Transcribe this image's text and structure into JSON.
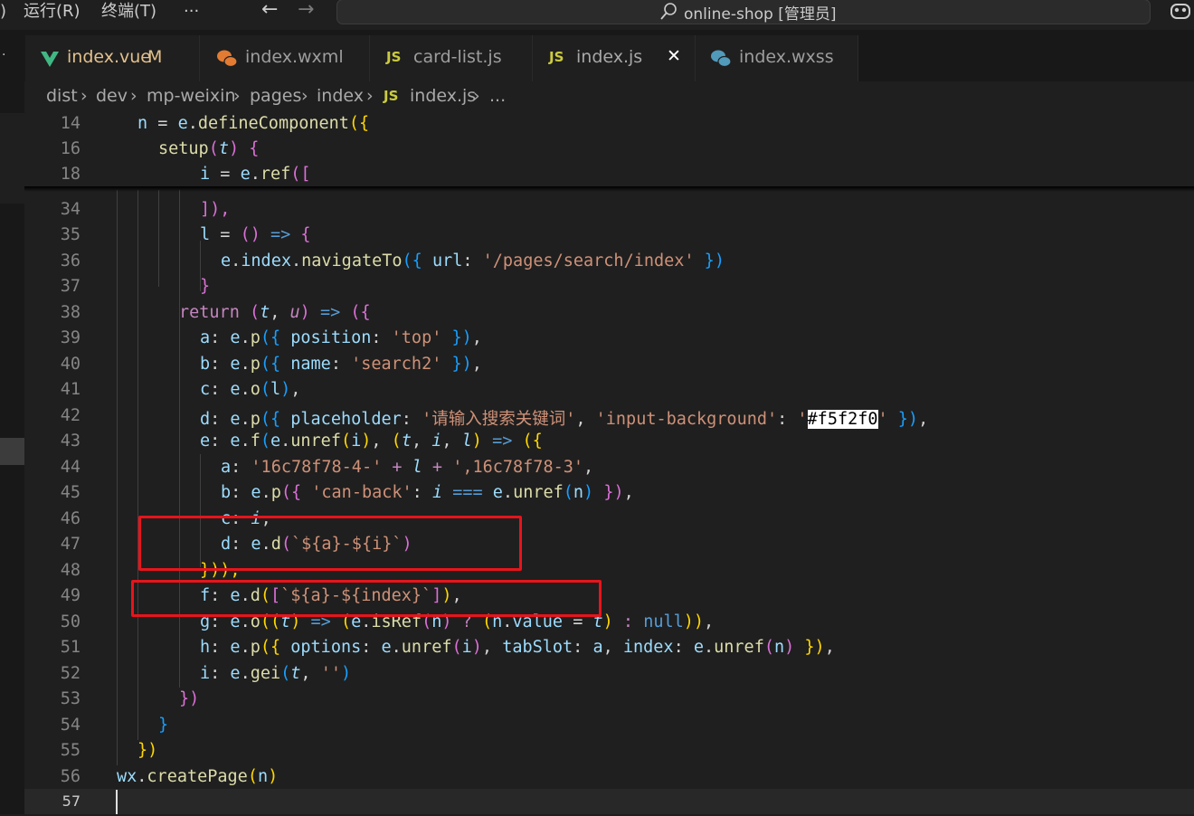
{
  "menu": {
    "run": "运行(R)",
    "terminal": "终端(T)",
    "more": "···",
    "back_icon": "←",
    "forward_icon": "→"
  },
  "command_center": {
    "text": "online-shop [管理员]"
  },
  "tabs": [
    {
      "label": "index.vue",
      "badge": "M",
      "icon": "vue-icon"
    },
    {
      "label": "index.wxml",
      "icon": "wechat-icon"
    },
    {
      "label": "card-list.js",
      "icon_text": "JS"
    },
    {
      "label": "index.js",
      "icon_text": "JS",
      "close": "✕"
    },
    {
      "label": "index.wxss",
      "icon": "wechat-icon"
    }
  ],
  "breadcrumb": [
    "dist",
    "dev",
    "mp-weixin",
    "pages",
    "index",
    "index.js",
    "..."
  ],
  "breadcrumb_js": "JS",
  "lines": {
    "l14": "14",
    "l16": "16",
    "l18": "18",
    "l34": "34",
    "l35": "35",
    "l36": "36",
    "l37": "37",
    "l38": "38",
    "l39": "39",
    "l40": "40",
    "l41": "41",
    "l42": "42",
    "l43": "43",
    "l44": "44",
    "l45": "45",
    "l46": "46",
    "l47": "47",
    "l48": "48",
    "l49": "49",
    "l50": "50",
    "l51": "51",
    "l52": "52",
    "l53": "53",
    "l54": "54",
    "l55": "55",
    "l56": "56",
    "l57": "57"
  },
  "code": {
    "c14a": "n",
    "c14b": " = ",
    "c14c": "e",
    ".": ".",
    "c14d": "defineComponent",
    "c14e": "({",
    "c16a": "setup",
    "c16b": "(",
    "c16c": "t",
    "c16d": ") {",
    "c18a": "i",
    "c18b": " = ",
    "c18c": "e",
    "c18d": "ref",
    "c18e": "([",
    "c34": "]),",
    "c35a": "l",
    "c35b": " = ",
    "c35c": "()",
    "c35d": " => ",
    "c35e": "{",
    "c36a": "e",
    "c36b": "index",
    "c36c": "navigateTo",
    "c36d": "({ ",
    "c36e": "url",
    "c36f": ": ",
    "c36g": "'/pages/search/index'",
    "c36h": " })",
    "c37": "}",
    "c38a": "return",
    "c38b": " (",
    "c38c": "t",
    "c38d": ", ",
    "c38e": "u",
    "c38f": ")",
    "c38g": " => ",
    "c38h": "({",
    "c39a": "a",
    "c39b": ": ",
    "c39c": "e",
    "c39d": "p",
    "c39e": "({ ",
    "c39f": "position",
    "c39g": "'top'",
    "c39h": " }),",
    "c40a": "b",
    "c40c": "e",
    "c40d": "p",
    "c40f": "name",
    "c40g": "'search2'",
    "c41a": "c",
    "c41c": "e",
    "c41d": "o",
    "c41e": "(",
    "c41f": "l",
    "c41g": "),",
    "c42a": "d",
    "c42c": "e",
    "c42d": "p",
    "c42f": "placeholder",
    "c42g": "'请输入搜索关键词'",
    "c42h": "'input-background'",
    "c42i": "'",
    "c42j": "#f5f2f0",
    "c42k": "'",
    "c42l": " }),",
    "c43a": "e",
    "c43c": "e",
    "c43d": "f",
    "c43e": "(",
    "c43f": "e",
    "c43g": "unref",
    "c43h": "i",
    "c43i": "t",
    "c43j": "i",
    "c43k": "l",
    "c43l": "({",
    "c44a": "a",
    "c44b": "'16c78f78-4-'",
    "c44c": " + ",
    "c44d": "l",
    "c44e": "',16c78f78-3'",
    "c45a": "b",
    "c45c": "e",
    "c45d": "p",
    "c45f": "'can-back'",
    "c45g": "i",
    "c45h": " === ",
    "c45i": "e",
    "c45j": "unref",
    "c45k": "n",
    "c46a": "c",
    "c46b": "i",
    "c47a": "d",
    "c47c": "e",
    "c47d": "d",
    "c47e": "`${a}-${i}`",
    "c48": "})),",
    "c49a": "f",
    "c49c": "e",
    "c49d": "d",
    "c49e": "`${a}-${index}`",
    "c50a": "g",
    "c50c": "e",
    "c50d": "o",
    "c50e": "t",
    "c50f": "e",
    "c50g": "isRef",
    "c50h": "n",
    "c50i": "n",
    "c50j": "value",
    "c50k": "t",
    "c50l": "null",
    "c51a": "h",
    "c51c": "e",
    "c51d": "p",
    "c51f": "options",
    "c51g": "e",
    "c51h": "unref",
    "c51i": "i",
    "c51j": "tabSlot",
    "c51k": "a",
    "c51l": "index",
    "c51m": "e",
    "c51n": "unref",
    "c51o": "n",
    "c52a": "i",
    "c52c": "e",
    "c52d": "gei",
    "c52e": "t",
    "c52f": "''",
    "c53": "})",
    "c54": "}",
    "c55": "})",
    "c56a": "wx",
    "c56b": "createPage",
    "c56c": "n"
  },
  "colors": {
    "keyword": "#c586c0",
    "function": "#dcdcaa",
    "variable": "#9cdcfe",
    "string": "#ce9178",
    "highlight_box": "#e8141b"
  }
}
